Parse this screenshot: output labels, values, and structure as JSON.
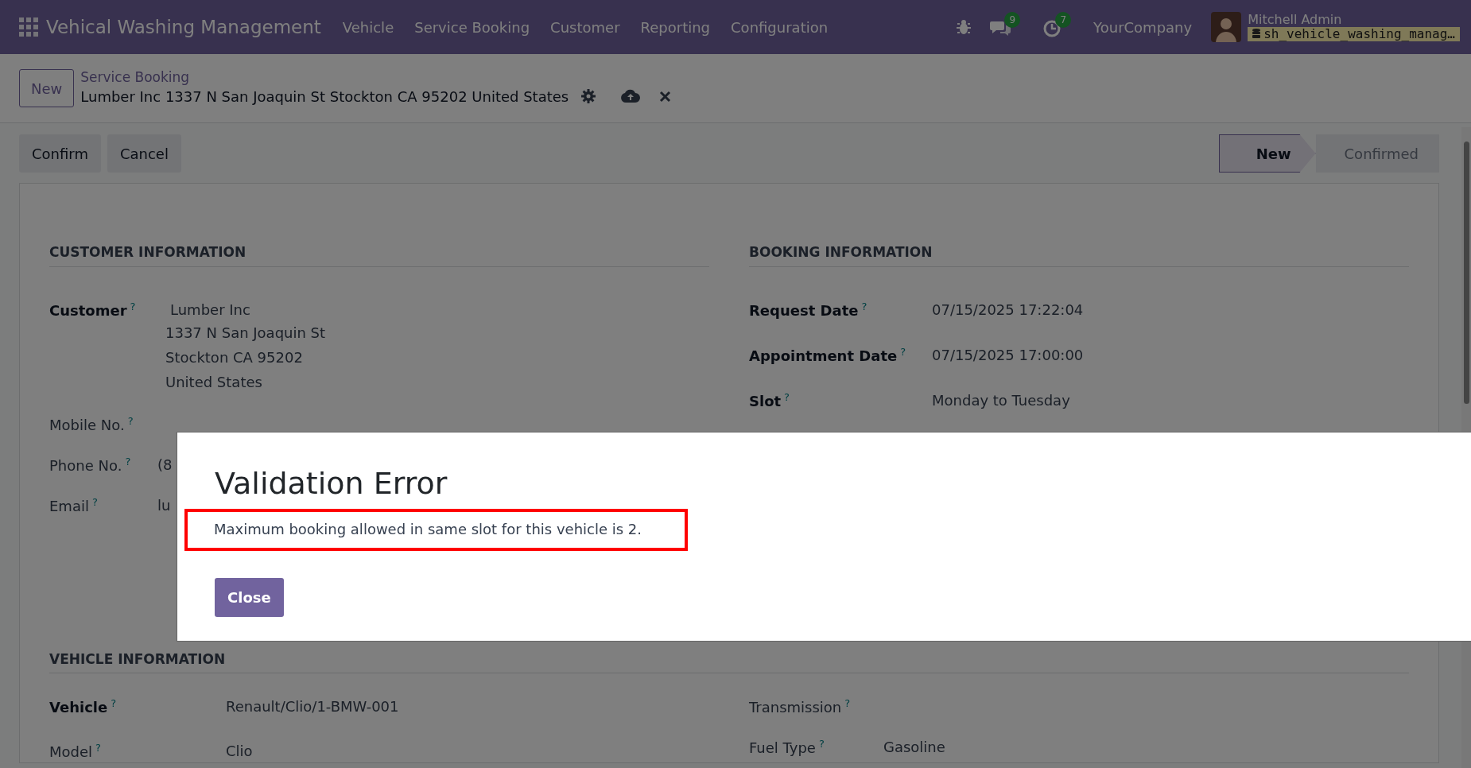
{
  "navbar": {
    "app_name": "Vehical Washing Management",
    "menu": [
      "Vehicle",
      "Service Booking",
      "Customer",
      "Reporting",
      "Configuration"
    ],
    "chat_count": "9",
    "activity_count": "7",
    "company": "YourCompany",
    "user": "Mitchell Admin",
    "database": "sh_vehicle_washing_manag…"
  },
  "control_panel": {
    "new_button": "New",
    "breadcrumb": "Service Booking",
    "record_title": "Lumber Inc 1337 N San Joaquin St Stockton CA 95202 United States"
  },
  "actions": [
    "Confirm",
    "Cancel"
  ],
  "status_bar": [
    {
      "label": "New",
      "selected": true
    },
    {
      "label": "Confirmed",
      "selected": false
    }
  ],
  "sections": [
    {
      "columns": [
        {
          "title": "CUSTOMER INFORMATION",
          "fields": [
            {
              "label": "Customer",
              "help": "?",
              "required": true,
              "value": "Lumber Inc",
              "address_lines": [
                "1337 N San Joaquin St",
                "Stockton CA 95202",
                "United States"
              ]
            },
            {
              "label": "Mobile No.",
              "help": "?",
              "required": false
            },
            {
              "label": "Phone No.",
              "help": "?",
              "required": false,
              "value": "(8"
            },
            {
              "label": "Email",
              "help": "?",
              "required": false,
              "value": "lu"
            }
          ]
        },
        {
          "title": "BOOKING INFORMATION",
          "fields": [
            {
              "label": "Request Date",
              "help": "?",
              "required": true,
              "value": "07/15/2025 17:22:04"
            },
            {
              "label": "Appointment Date",
              "help": "?",
              "required": true,
              "value": "07/15/2025 17:00:00"
            },
            {
              "label": "Slot",
              "help": "?",
              "required": true,
              "value": "Monday to Tuesday"
            }
          ]
        }
      ]
    },
    {
      "title": "VEHICLE INFORMATION",
      "columns": [
        {
          "fields": [
            {
              "label": "Vehicle",
              "help": "?",
              "required": true,
              "value": "Renault/Clio/1-BMW-001"
            },
            {
              "label": "Model",
              "help": "?",
              "required": false,
              "value": "Clio"
            }
          ]
        },
        {
          "fields": [
            {
              "label": "Transmission",
              "help": "?",
              "required": false
            },
            {
              "label": "Fuel Type",
              "help": "?",
              "required": false,
              "value": "Gasoline"
            }
          ]
        }
      ]
    }
  ],
  "dialog": {
    "title": "Validation Error",
    "message": "Maximum booking allowed in same slot for this vehicle is 2.",
    "highlighted": true,
    "button": "Close"
  }
}
